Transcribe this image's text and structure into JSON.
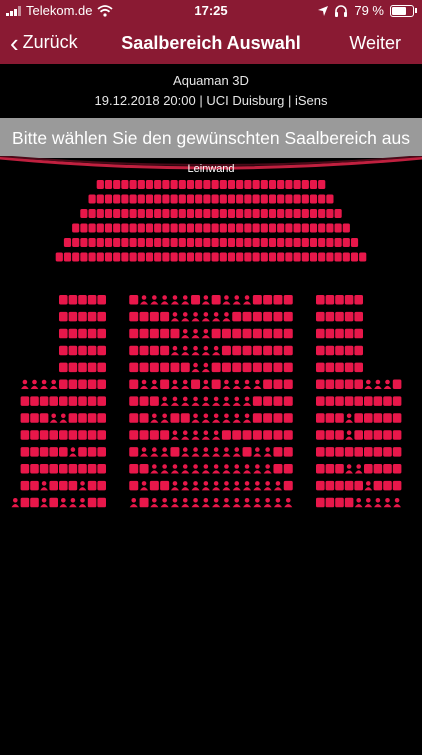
{
  "status_bar": {
    "carrier": "Telekom.de",
    "time": "17:25",
    "battery": "79 %",
    "battery_level": 0.79
  },
  "nav": {
    "back_label": "Zurück",
    "title": "Saalbereich Auswahl",
    "next_label": "Weiter"
  },
  "event": {
    "movie": "Aquaman 3D",
    "details": "19.12.2018 20:00 | UCI Duisburg | iSens"
  },
  "instruction": "Bitte wählen Sie den gewünschten Saalbereich aus",
  "screen_label": "Leinwand",
  "colors": {
    "header": "#8a1a33",
    "seat": "#e8174a",
    "banner": "#9a9a9a"
  },
  "seat_map": {
    "blocks": [
      {
        "name": "balcony",
        "rows": [
          {
            "count": 28
          },
          {
            "count": 30
          },
          {
            "count": 32
          },
          {
            "count": 34
          },
          {
            "count": 36
          },
          {
            "count": 38
          }
        ]
      },
      {
        "name": "left",
        "rows": [
          {
            "count": 5,
            "icons": []
          },
          {
            "count": 5,
            "icons": []
          },
          {
            "count": 5,
            "icons": []
          },
          {
            "count": 5,
            "icons": []
          },
          {
            "count": 5,
            "icons": []
          },
          {
            "count": 9,
            "icons": [
              0,
              1,
              2,
              3
            ]
          },
          {
            "count": 9,
            "icons": []
          },
          {
            "count": 9,
            "icons": [
              3,
              4
            ]
          },
          {
            "count": 9,
            "icons": []
          },
          {
            "count": 9,
            "icons": [
              5
            ]
          },
          {
            "count": 9,
            "icons": []
          },
          {
            "count": 9,
            "icons": [
              2,
              6
            ]
          },
          {
            "count": 10,
            "icons": [
              0,
              3,
              5,
              6,
              7
            ]
          }
        ]
      },
      {
        "name": "center",
        "rows": [
          {
            "count": 16,
            "icons": [
              1,
              2,
              3,
              4,
              5,
              7,
              9,
              10,
              11
            ]
          },
          {
            "count": 16,
            "icons": [
              4,
              5,
              6,
              7,
              8,
              9
            ]
          },
          {
            "count": 16,
            "icons": [
              5,
              6,
              7
            ]
          },
          {
            "count": 16,
            "icons": [
              4,
              5,
              6,
              7,
              8
            ]
          },
          {
            "count": 16,
            "icons": [
              6,
              7
            ]
          },
          {
            "count": 16,
            "icons": [
              1,
              2,
              4,
              5,
              7,
              9,
              10,
              11,
              12
            ]
          },
          {
            "count": 16,
            "icons": [
              3,
              4,
              5,
              6,
              7,
              8,
              9,
              10,
              11
            ]
          },
          {
            "count": 16,
            "icons": [
              2,
              3,
              6,
              7,
              8,
              9,
              10,
              11
            ]
          },
          {
            "count": 16,
            "icons": [
              4,
              5,
              6,
              7,
              8
            ]
          },
          {
            "count": 16,
            "icons": [
              1,
              2,
              3,
              5,
              6,
              7,
              8,
              9,
              10,
              12,
              13
            ]
          },
          {
            "count": 16,
            "icons": [
              2,
              3,
              4,
              5,
              6,
              7,
              8,
              9,
              10,
              11,
              12,
              13
            ]
          },
          {
            "count": 16,
            "icons": [
              1,
              4,
              5,
              6,
              7,
              8,
              9,
              10,
              11,
              12,
              13,
              14
            ]
          },
          {
            "count": 16,
            "icons": [
              0,
              2,
              3,
              4,
              5,
              6,
              7,
              8,
              9,
              10,
              11,
              12,
              13,
              14,
              15
            ]
          }
        ]
      },
      {
        "name": "right",
        "rows": [
          {
            "count": 5,
            "icons": []
          },
          {
            "count": 5,
            "icons": []
          },
          {
            "count": 5,
            "icons": []
          },
          {
            "count": 5,
            "icons": []
          },
          {
            "count": 5,
            "icons": []
          },
          {
            "count": 9,
            "icons": [
              5,
              6,
              7
            ]
          },
          {
            "count": 9,
            "icons": []
          },
          {
            "count": 9,
            "icons": [
              3
            ]
          },
          {
            "count": 9,
            "icons": [
              3
            ]
          },
          {
            "count": 9,
            "icons": []
          },
          {
            "count": 9,
            "icons": [
              3,
              4
            ]
          },
          {
            "count": 9,
            "icons": [
              5
            ]
          },
          {
            "count": 9,
            "icons": [
              4,
              5,
              6,
              7,
              8
            ]
          }
        ]
      }
    ]
  }
}
